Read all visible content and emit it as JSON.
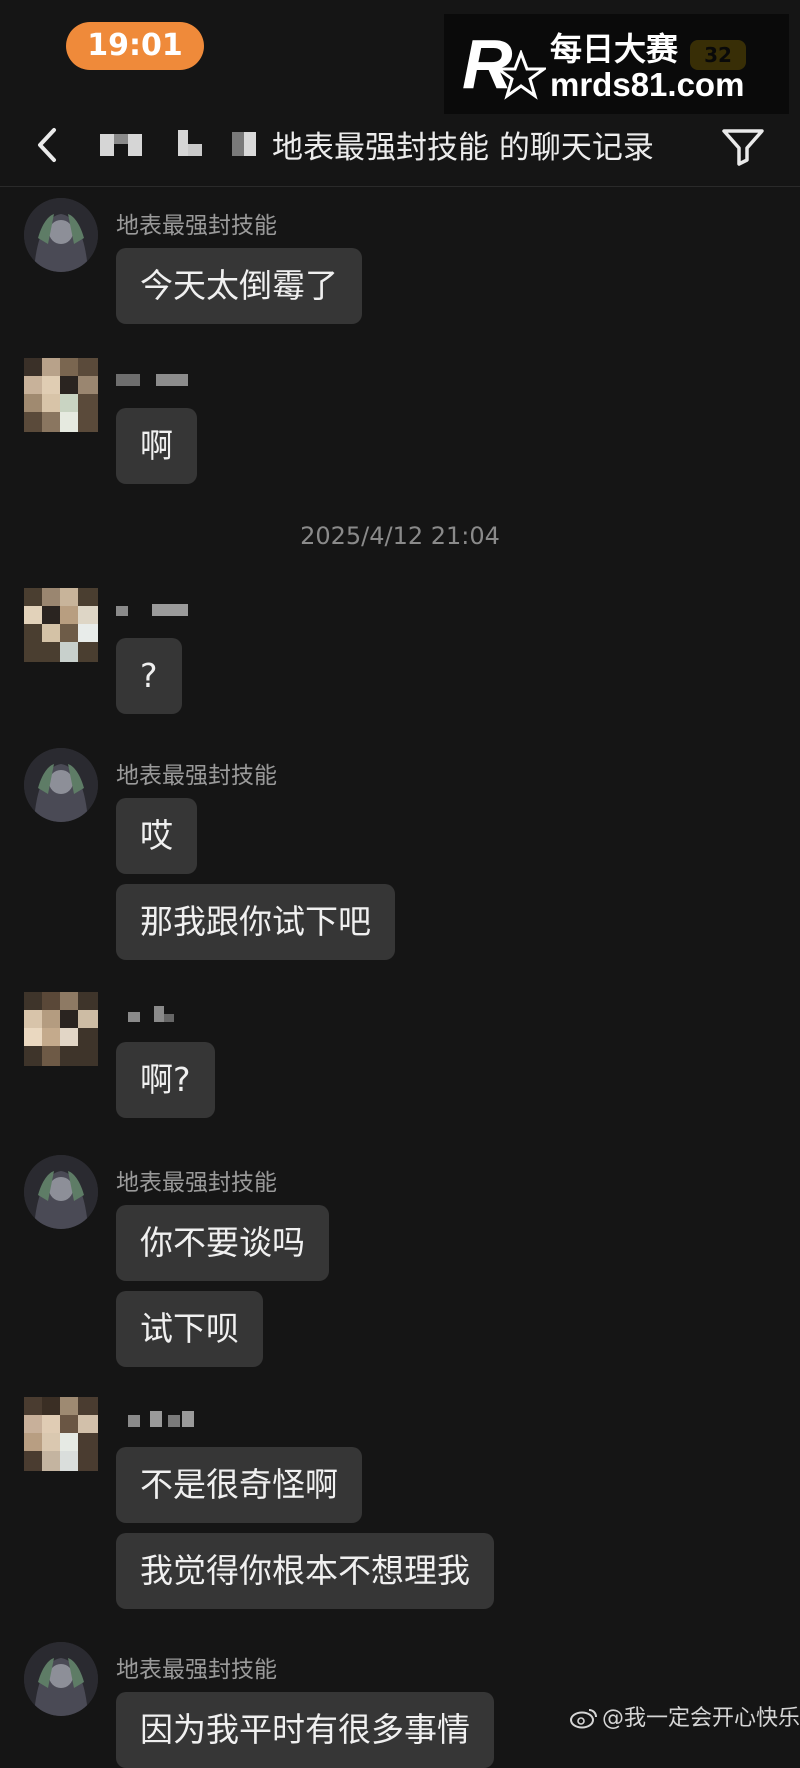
{
  "status_bar": {
    "time": "19:01",
    "battery": "32"
  },
  "watermark": {
    "logo": "R",
    "title": "每日大赛",
    "url": "mrds81.com"
  },
  "header": {
    "title": "地表最强封技能 的聊天记录",
    "back_icon": "chevron-left-icon",
    "filter_icon": "filter-icon"
  },
  "messages": [
    {
      "sender": "地表最强封技能",
      "texts": [
        "今天太倒霉了"
      ]
    },
    {
      "sender": "",
      "texts": [
        "啊"
      ]
    },
    {
      "sender": "",
      "texts": [
        "?"
      ]
    },
    {
      "sender": "地表最强封技能",
      "texts": [
        "哎",
        "那我跟你试下吧"
      ]
    },
    {
      "sender": "",
      "texts": [
        "啊?"
      ]
    },
    {
      "sender": "地表最强封技能",
      "texts": [
        "你不要谈吗",
        "试下呗"
      ]
    },
    {
      "sender": "",
      "texts": [
        "不是很奇怪啊",
        "我觉得你根本不想理我"
      ]
    },
    {
      "sender": "地表最强封技能",
      "texts": [
        "因为我平时有很多事情"
      ]
    }
  ],
  "timestamp": "2025/4/12 21:04",
  "credit": "@我一定会开心快乐",
  "colors": {
    "background": "#151515",
    "bubble": "#363636",
    "time_pill": "#ef8a3a"
  }
}
